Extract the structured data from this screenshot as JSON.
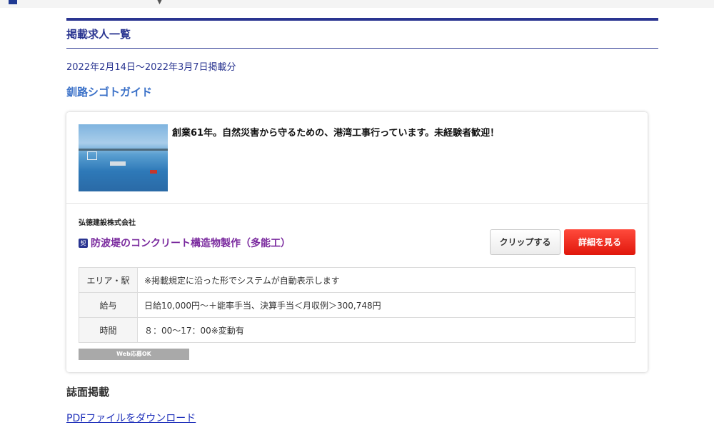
{
  "section": {
    "heading": "掲載求人一覧",
    "period": "2022年2月14日～2022年3月7日掲載分",
    "source": "釧路シゴトガイド"
  },
  "job": {
    "catch_copy": "創業61年。自然災害から守るための、港湾工事行っています。未経験者歓迎！",
    "company": "弘徳建設株式会社",
    "employment_badge": "契",
    "title": "防波堤のコンクリート構造物製作（多能工）",
    "clip_label": "クリップする",
    "detail_label": "詳細を見る",
    "rows": [
      {
        "key": "エリア・駅",
        "value": "※掲載規定に沿った形でシステムが自動表示します"
      },
      {
        "key": "給与",
        "value": "日給10,000円～＋能率手当、決算手当＜月収例＞300,748円"
      },
      {
        "key": "時間",
        "value": "８：00～17：00※変動有"
      }
    ],
    "web_badge": "Web応募OK"
  },
  "print": {
    "heading": "誌面掲載",
    "pdf_link": "PDFファイルをダウンロード"
  },
  "colors": {
    "accent": "#2a3591",
    "source_link": "#3b71c8",
    "title": "#7a2a9e",
    "detail_button": "#e0170c"
  }
}
